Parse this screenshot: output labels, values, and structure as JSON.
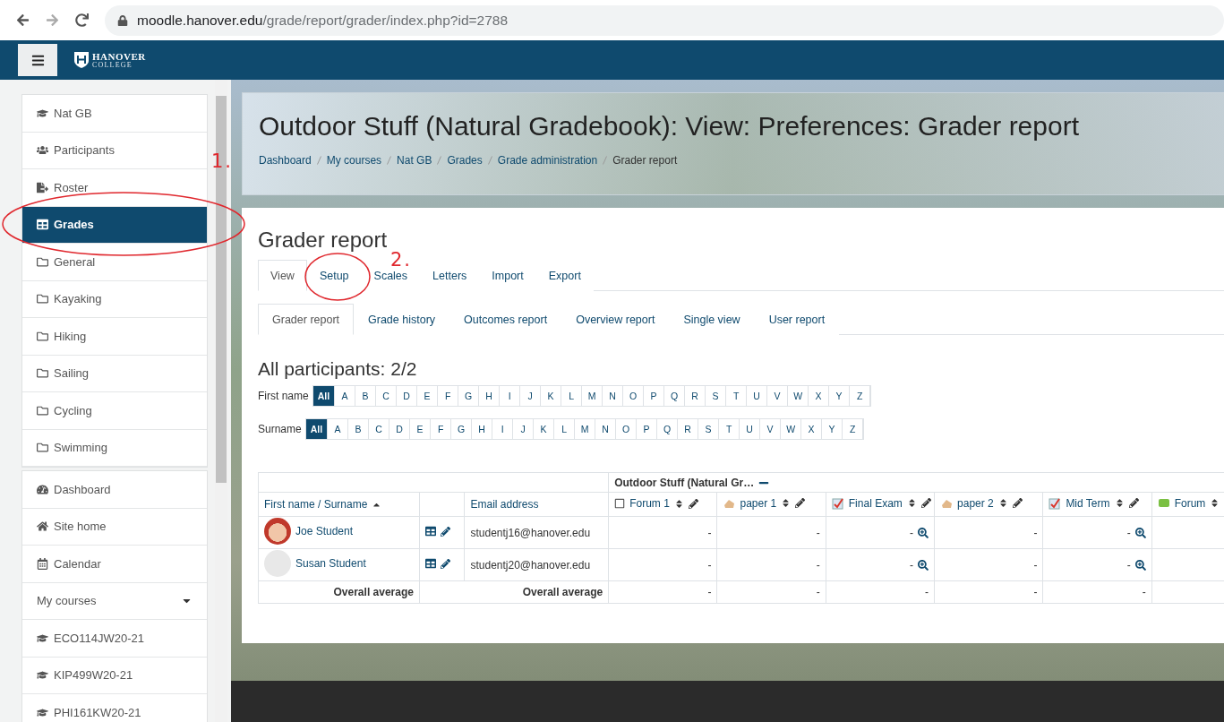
{
  "browser": {
    "url_host": "moodle.hanover.edu",
    "url_path": "/grade/report/grader/index.php?id=2788"
  },
  "navbar": {
    "logo_text": "HANOVER",
    "logo_subtext": "COLLEGE"
  },
  "sidebar": {
    "groups": [
      [
        {
          "label": "Nat GB",
          "kind": "course",
          "selected": false
        },
        {
          "label": "Participants",
          "kind": "participants",
          "selected": false
        },
        {
          "label": "Roster",
          "kind": "roster",
          "selected": false
        },
        {
          "label": "Grades",
          "kind": "grades",
          "selected": true
        },
        {
          "label": "General",
          "kind": "folder",
          "selected": false
        },
        {
          "label": "Kayaking",
          "kind": "folder",
          "selected": false
        },
        {
          "label": "Hiking",
          "kind": "folder",
          "selected": false
        },
        {
          "label": "Sailing",
          "kind": "folder",
          "selected": false
        },
        {
          "label": "Cycling",
          "kind": "folder",
          "selected": false
        },
        {
          "label": "Swimming",
          "kind": "folder",
          "selected": false
        }
      ],
      [
        {
          "label": "Dashboard",
          "kind": "dashboard",
          "selected": false
        },
        {
          "label": "Site home",
          "kind": "home",
          "selected": false
        },
        {
          "label": "Calendar",
          "kind": "calendar",
          "selected": false
        },
        {
          "label": "My courses",
          "kind": "dropdown",
          "selected": false
        },
        {
          "label": "ECO114JW20-21",
          "kind": "course",
          "selected": false
        },
        {
          "label": "KIP499W20-21",
          "kind": "course",
          "selected": false
        },
        {
          "label": "PHI161KW20-21",
          "kind": "course",
          "selected": false
        }
      ]
    ]
  },
  "header": {
    "title": "Outdoor Stuff (Natural Gradebook): View: Preferences: Grader report",
    "breadcrumbs": [
      "Dashboard",
      "My courses",
      "Nat GB",
      "Grades",
      "Grade administration",
      "Grader report"
    ]
  },
  "heading": "Grader report",
  "tabs": [
    {
      "label": "View",
      "selected": true
    },
    {
      "label": "Setup",
      "selected": false
    },
    {
      "label": "Scales",
      "selected": false
    },
    {
      "label": "Letters",
      "selected": false
    },
    {
      "label": "Import",
      "selected": false
    },
    {
      "label": "Export",
      "selected": false
    }
  ],
  "subtabs": [
    {
      "label": "Grader report",
      "selected": true
    },
    {
      "label": "Grade history",
      "selected": false
    },
    {
      "label": "Outcomes report",
      "selected": false
    },
    {
      "label": "Overview report",
      "selected": false
    },
    {
      "label": "Single view",
      "selected": false
    },
    {
      "label": "User report",
      "selected": false
    }
  ],
  "participants_heading": "All participants: 2/2",
  "filters": [
    {
      "label": "First name",
      "letters": [
        {
          "label": "All",
          "selected": true
        },
        {
          "label": "A",
          "selected": false
        },
        {
          "label": "B",
          "selected": false
        },
        {
          "label": "C",
          "selected": false
        },
        {
          "label": "D",
          "selected": false
        },
        {
          "label": "E",
          "selected": false
        },
        {
          "label": "F",
          "selected": false
        },
        {
          "label": "G",
          "selected": false
        },
        {
          "label": "H",
          "selected": false
        },
        {
          "label": "I",
          "selected": false
        },
        {
          "label": "J",
          "selected": false
        },
        {
          "label": "K",
          "selected": false
        },
        {
          "label": "L",
          "selected": false
        },
        {
          "label": "M",
          "selected": false
        },
        {
          "label": "N",
          "selected": false
        },
        {
          "label": "O",
          "selected": false
        },
        {
          "label": "P",
          "selected": false
        },
        {
          "label": "Q",
          "selected": false
        },
        {
          "label": "R",
          "selected": false
        },
        {
          "label": "S",
          "selected": false
        },
        {
          "label": "T",
          "selected": false
        },
        {
          "label": "U",
          "selected": false
        },
        {
          "label": "V",
          "selected": false
        },
        {
          "label": "W",
          "selected": false
        },
        {
          "label": "X",
          "selected": false
        },
        {
          "label": "Y",
          "selected": false
        },
        {
          "label": "Z",
          "selected": false
        }
      ]
    },
    {
      "label": "Surname",
      "letters": [
        {
          "label": "All",
          "selected": true
        },
        {
          "label": "A",
          "selected": false
        },
        {
          "label": "B",
          "selected": false
        },
        {
          "label": "C",
          "selected": false
        },
        {
          "label": "D",
          "selected": false
        },
        {
          "label": "E",
          "selected": false
        },
        {
          "label": "F",
          "selected": false
        },
        {
          "label": "G",
          "selected": false
        },
        {
          "label": "H",
          "selected": false
        },
        {
          "label": "I",
          "selected": false
        },
        {
          "label": "J",
          "selected": false
        },
        {
          "label": "K",
          "selected": false
        },
        {
          "label": "L",
          "selected": false
        },
        {
          "label": "M",
          "selected": false
        },
        {
          "label": "N",
          "selected": false
        },
        {
          "label": "O",
          "selected": false
        },
        {
          "label": "P",
          "selected": false
        },
        {
          "label": "Q",
          "selected": false
        },
        {
          "label": "R",
          "selected": false
        },
        {
          "label": "S",
          "selected": false
        },
        {
          "label": "T",
          "selected": false
        },
        {
          "label": "U",
          "selected": false
        },
        {
          "label": "V",
          "selected": false
        },
        {
          "label": "W",
          "selected": false
        },
        {
          "label": "X",
          "selected": false
        },
        {
          "label": "Y",
          "selected": false
        },
        {
          "label": "Z",
          "selected": false
        }
      ]
    }
  ],
  "table": {
    "category": "Outdoor Stuff (Natural Gr…",
    "columns": [
      {
        "kind": "name",
        "label": "First name / Surname"
      },
      {
        "kind": "actions"
      },
      {
        "kind": "email",
        "label": "Email address"
      },
      {
        "kind": "grade-checkbox",
        "label": "Forum 1"
      },
      {
        "kind": "grade-assignment",
        "label": "paper 1"
      },
      {
        "kind": "grade-quiz",
        "label": "Final Exam"
      },
      {
        "kind": "grade-assignment",
        "label": "paper 2"
      },
      {
        "kind": "grade-quiz",
        "label": "Mid Term"
      },
      {
        "kind": "grade-forum",
        "label": "Forum"
      }
    ],
    "rows": [
      {
        "kind": "student-picture",
        "name": "Joe Student",
        "email": "studentj16@hanover.edu",
        "grades": [
          {
            "value": "-",
            "kind": "plain"
          },
          {
            "value": "-",
            "kind": "plain"
          },
          {
            "value": "-",
            "kind": "analysis"
          },
          {
            "value": "-",
            "kind": "plain"
          },
          {
            "value": "-",
            "kind": "analysis"
          }
        ]
      },
      {
        "kind": "student-default",
        "name": "Susan Student",
        "email": "studentj20@hanover.edu",
        "grades": [
          {
            "value": "-",
            "kind": "plain"
          },
          {
            "value": "-",
            "kind": "plain"
          },
          {
            "value": "-",
            "kind": "analysis"
          },
          {
            "value": "-",
            "kind": "plain"
          },
          {
            "value": "-",
            "kind": "analysis"
          }
        ]
      },
      {
        "kind": "average",
        "name": "Overall average",
        "email": "Overall average",
        "grades": [
          {
            "value": "-",
            "kind": "plain"
          },
          {
            "value": "-",
            "kind": "plain"
          },
          {
            "value": "-",
            "kind": "plain"
          },
          {
            "value": "-",
            "kind": "plain"
          },
          {
            "value": "-",
            "kind": "plain"
          }
        ]
      }
    ]
  },
  "annotations": [
    {
      "label": "1.",
      "kind": "sidebar"
    },
    {
      "label": "2.",
      "kind": "tabs"
    }
  ]
}
